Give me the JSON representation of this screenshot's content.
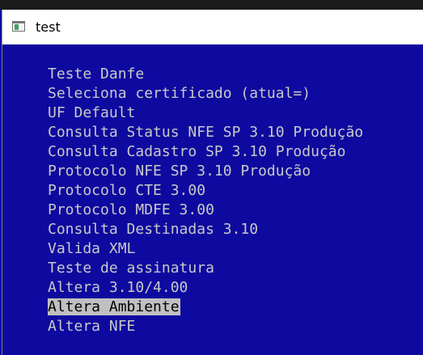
{
  "window": {
    "title": "test",
    "icon": "console-window-icon"
  },
  "menu": {
    "items": [
      {
        "label": "Teste Danfe",
        "selected": false
      },
      {
        "label": "Seleciona certificado (atual=)",
        "selected": false
      },
      {
        "label": "UF Default",
        "selected": false
      },
      {
        "label": "Consulta Status NFE SP 3.10 Produção",
        "selected": false
      },
      {
        "label": "Consulta Cadastro SP 3.10 Produção",
        "selected": false
      },
      {
        "label": "Protocolo NFE SP 3.10 Produção",
        "selected": false
      },
      {
        "label": "Protocolo CTE 3.00",
        "selected": false
      },
      {
        "label": "Protocolo MDFE 3.00",
        "selected": false
      },
      {
        "label": "Consulta Destinadas 3.10",
        "selected": false
      },
      {
        "label": "Valida XML",
        "selected": false
      },
      {
        "label": "Teste de assinatura",
        "selected": false
      },
      {
        "label": "Altera 3.10/4.00",
        "selected": false
      },
      {
        "label": "Altera Ambiente",
        "selected": true
      },
      {
        "label": "Altera NFE",
        "selected": false
      }
    ]
  },
  "colors": {
    "background": "#0e0a9f",
    "text": "#c9c9c9",
    "highlight_bg": "#c0c0c0",
    "highlight_text": "#000000"
  }
}
